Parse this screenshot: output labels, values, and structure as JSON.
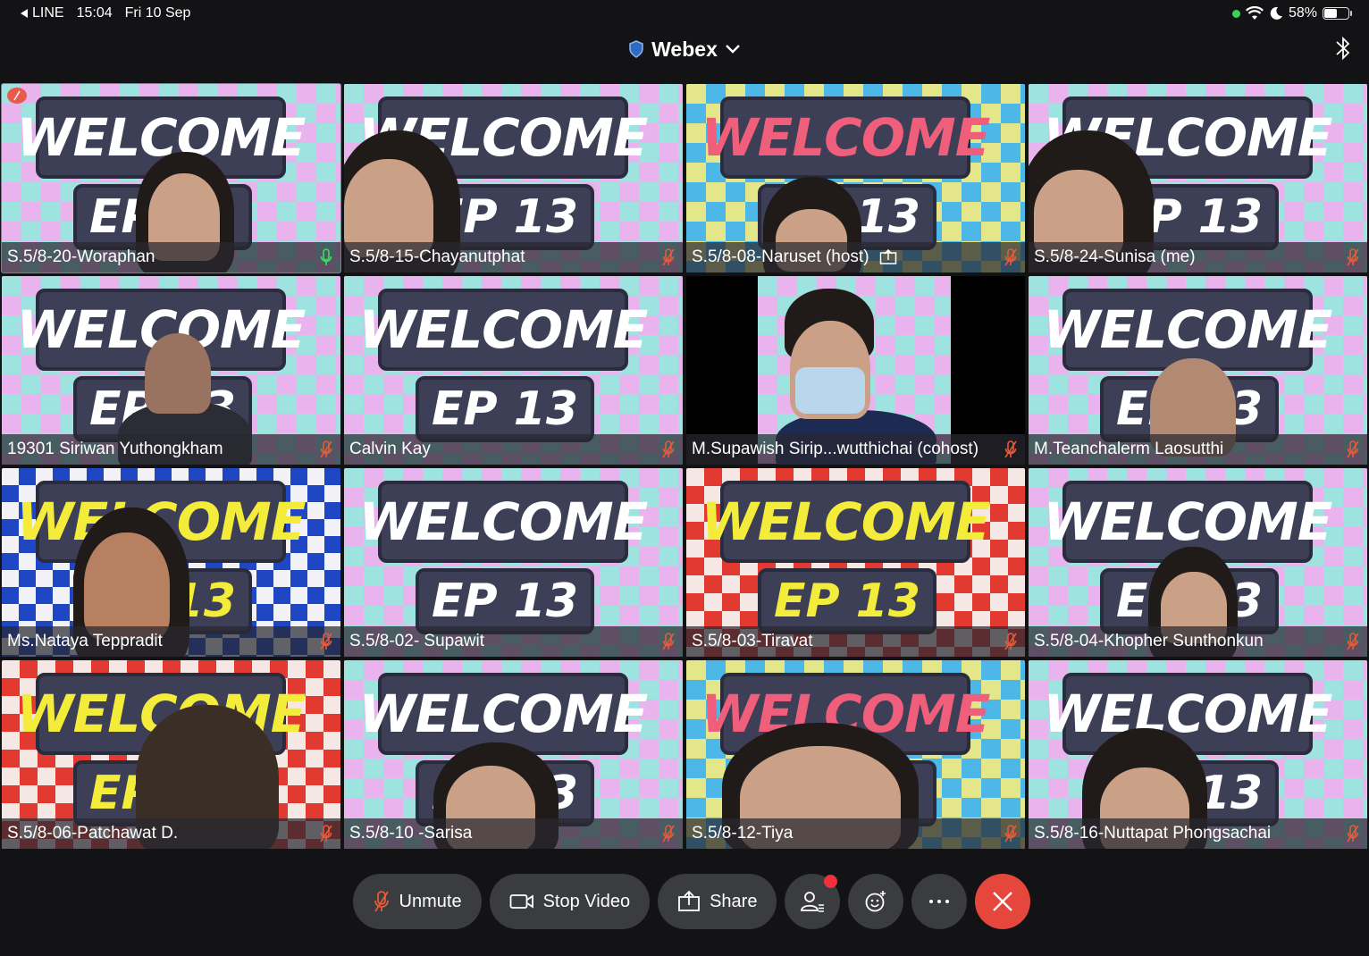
{
  "status_bar": {
    "back_app": "LINE",
    "time": "15:04",
    "date": "Fri 10 Sep",
    "battery": "58%",
    "battery_level": 0.58
  },
  "header": {
    "title": "Webex",
    "title_icon": "shield-icon",
    "dropdown_icon": "chevron-down-icon",
    "right_icon": "bluetooth-icon"
  },
  "participants": [
    {
      "name": "S.5/8-20-Woraphan",
      "mic": "mic-on-icon",
      "active": true
    },
    {
      "name": "S.5/8-15-Chayanutphat",
      "mic": "mic-muted-icon"
    },
    {
      "name": "S.5/8-08-Naruset (host)",
      "mic": "mic-muted-icon",
      "sharing": true
    },
    {
      "name": "S.5/8-24-Sunisa (me)",
      "mic": "mic-muted-icon"
    },
    {
      "name": "19301 Siriwan Yuthongkham",
      "mic": "mic-muted-icon"
    },
    {
      "name": "Calvin Kay",
      "mic": "mic-muted-icon"
    },
    {
      "name": "M.Supawish Sirip...wutthichai (cohost)",
      "mic": "mic-muted-icon"
    },
    {
      "name": "M.Teanchalerm Laosutthi",
      "mic": "mic-muted-icon"
    },
    {
      "name": "Ms.Nataya Teppradit",
      "mic": "mic-muted-icon"
    },
    {
      "name": "S.5/8-02- Supawit",
      "mic": "mic-muted-icon"
    },
    {
      "name": "S.5/8-03-Tiravat",
      "mic": "mic-muted-icon"
    },
    {
      "name": "S.5/8-04-Khopher Sunthonkun",
      "mic": "mic-muted-icon"
    },
    {
      "name": "S.5/8-06-Patchawat D.",
      "mic": "mic-muted-icon"
    },
    {
      "name": "S.5/8-10 -Sarisa",
      "mic": "mic-muted-icon"
    },
    {
      "name": "S.5/8-12-Tiya",
      "mic": "mic-muted-icon"
    },
    {
      "name": "S.5/8-16-Nuttapat Phongsachai",
      "mic": "mic-muted-icon"
    }
  ],
  "controls": {
    "unmute_label": "Unmute",
    "stop_video_label": "Stop Video",
    "share_label": "Share",
    "participants_icon": "participants-icon",
    "reactions_icon": "emoji-icon",
    "more_icon": "more-icon",
    "end_icon": "close-icon"
  },
  "colors": {
    "background": "#131315",
    "control_bg": "#3b3c40",
    "end_call": "#e5473d",
    "active_border": "#4a8ad8"
  }
}
